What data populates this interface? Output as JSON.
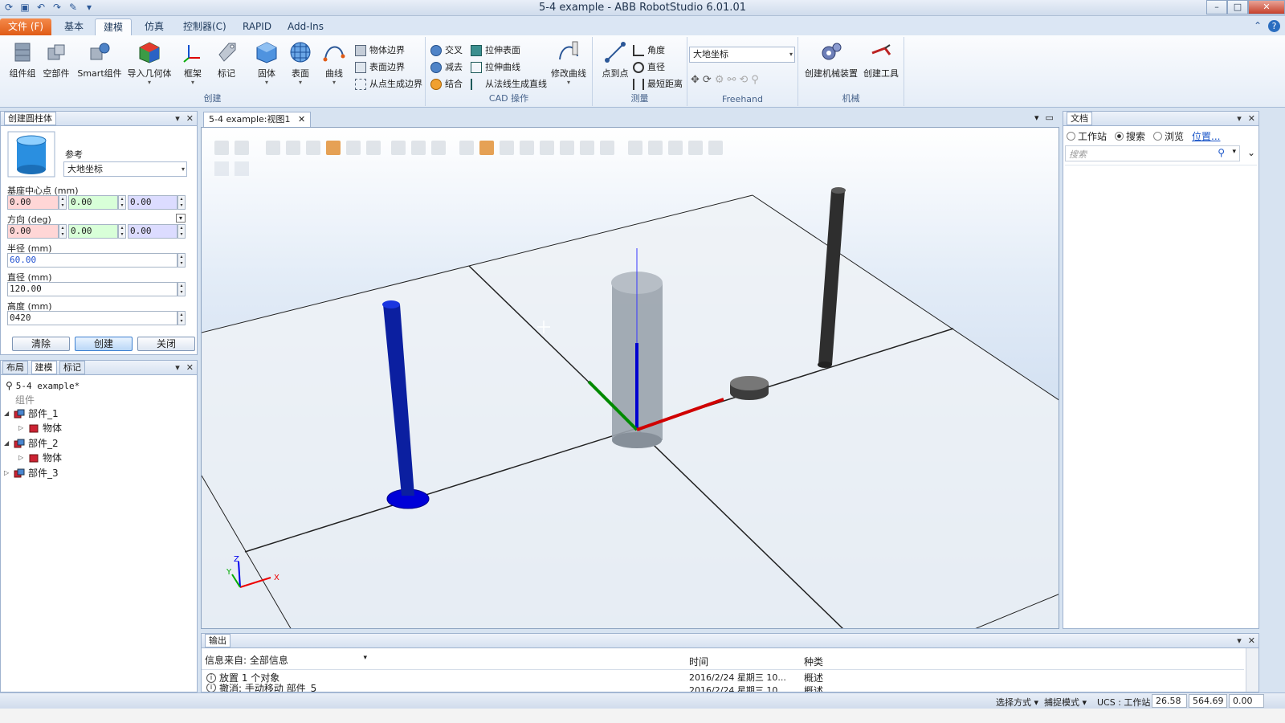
{
  "window": {
    "title": "5-4 example - ABB RobotStudio 6.01.01"
  },
  "ribbon_tabs": [
    "文件 (F)",
    "基本",
    "建模",
    "仿真",
    "控制器(C)",
    "RAPID",
    "Add-Ins"
  ],
  "ribbon": {
    "groups": {
      "create": {
        "label": "创建",
        "buttons": [
          "组件组",
          "空部件",
          "Smart组件",
          "导入几何体",
          "框架",
          "标记",
          "固体",
          "表面",
          "曲线"
        ],
        "small": [
          "物体边界",
          "表面边界",
          "从点生成边界"
        ]
      },
      "cad": {
        "label": "CAD 操作",
        "small": [
          "交叉",
          "减去",
          "结合",
          "拉伸表面",
          "拉伸曲线",
          "从法线生成直线"
        ],
        "button": "修改曲线"
      },
      "measure": {
        "label": "测量",
        "button": "点到点",
        "small": [
          "角度",
          "直径",
          "最短距离"
        ]
      },
      "freehand": {
        "label": "Freehand",
        "combo": "大地坐标"
      },
      "mechanism": {
        "label": "机械",
        "buttons": [
          "创建机械装置",
          "创建工具"
        ]
      }
    }
  },
  "create_cylinder": {
    "title": "创建圆柱体",
    "reference_label": "参考",
    "reference_value": "大地坐标",
    "base_center": {
      "label": "基座中心点 (mm)",
      "x": "0.00",
      "y": "0.00",
      "z": "0.00"
    },
    "orientation": {
      "label": "方向 (deg)",
      "x": "0.00",
      "y": "0.00",
      "z": "0.00"
    },
    "radius": {
      "label": "半径 (mm)",
      "value": "60.00"
    },
    "diameter": {
      "label": "直径 (mm)",
      "value": "120.00"
    },
    "height": {
      "label": "高度 (mm)",
      "value": "0420"
    },
    "buttons": {
      "clear": "清除",
      "create": "创建",
      "close": "关闭"
    }
  },
  "tree_panel": {
    "tabs": [
      "布局",
      "建模",
      "标记"
    ],
    "root": "5-4 example*",
    "group_label": "组件",
    "items": [
      {
        "label": "部件_1",
        "child": "物体"
      },
      {
        "label": "部件_2",
        "child": "物体"
      },
      {
        "label": "部件_3"
      }
    ]
  },
  "document_tab": "5-4 example:视图1",
  "axes": {
    "x": "X",
    "y": "Y",
    "z": "Z"
  },
  "docs_panel": {
    "title": "文档",
    "radios": [
      "工作站",
      "搜索",
      "浏览"
    ],
    "selected": "搜索",
    "link": "位置...",
    "search_placeholder": "搜索"
  },
  "output": {
    "title": "输出",
    "filter_label": "信息来自: 全部信息",
    "columns": [
      "时间",
      "种类"
    ],
    "rows": [
      {
        "msg": "放置 1 个对象",
        "time": "2016/2/24 星期三 10...",
        "kind": "概述"
      },
      {
        "msg": "撤消: 手动移动 部件_5",
        "time": "2016/2/24 星期三 10...",
        "kind": "概述"
      }
    ]
  },
  "status": {
    "select_mode": "选择方式",
    "snap_mode": "捕捉模式",
    "ucs": "UCS : 工作站",
    "coords": {
      "x": "26.58",
      "y": "564.69",
      "z": "0.00"
    }
  },
  "colors": {
    "accent": "#e05b16",
    "ribbon_text": "#1e395b",
    "axis_x": "#e00000",
    "axis_y": "#00a000",
    "axis_z": "#0000e0"
  }
}
